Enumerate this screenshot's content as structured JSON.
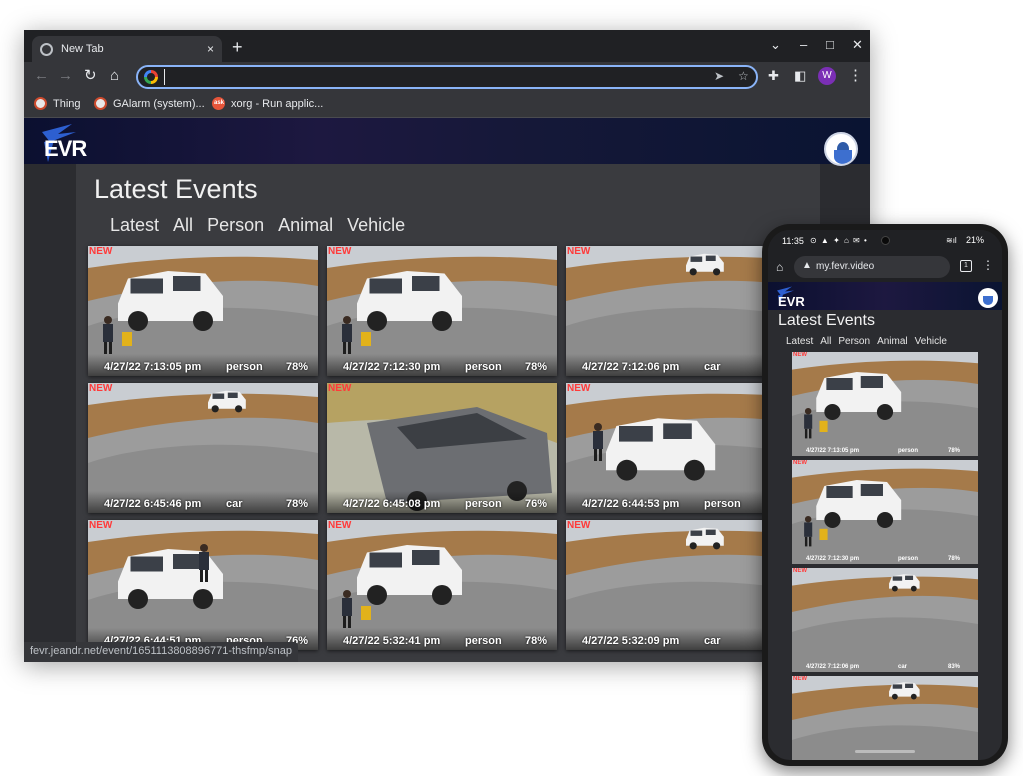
{
  "browser": {
    "tab_title": "New Tab",
    "tab_close": "×",
    "new_tab": "+",
    "window_controls": {
      "dropdown": "⌄",
      "minimize": "–",
      "maximize": "□",
      "close": "✕"
    },
    "address_value": "",
    "bookmarks": [
      {
        "label": "Thing",
        "icon": "thing-icon"
      },
      {
        "label": "GAlarm (system)...",
        "icon": "galarm-icon"
      },
      {
        "label": "xorg - Run applic...",
        "icon": "ask-icon",
        "icon_text": "ask"
      }
    ],
    "profile_initial": "W",
    "status_url": "fevr.jeandr.net/event/1651113808896771-thsfmp/snap"
  },
  "site": {
    "logo_text": "EVR",
    "page_title": "Latest Events",
    "filters": [
      "Latest",
      "All",
      "Person",
      "Animal",
      "Vehicle"
    ],
    "new_badge": "NEW",
    "events": [
      {
        "timestamp": "4/27/22 7:13:05 pm",
        "label": "person",
        "confidence": "78%",
        "scene": "suv-person"
      },
      {
        "timestamp": "4/27/22 7:12:30 pm",
        "label": "person",
        "confidence": "78%",
        "scene": "suv-person"
      },
      {
        "timestamp": "4/27/22 7:12:06 pm",
        "label": "car",
        "confidence": "",
        "scene": "far-car"
      },
      {
        "timestamp": "4/27/22 6:45:46 pm",
        "label": "car",
        "confidence": "78%",
        "scene": "far-car"
      },
      {
        "timestamp": "4/27/22 6:45:08 pm",
        "label": "person",
        "confidence": "76%",
        "scene": "minivan"
      },
      {
        "timestamp": "4/27/22 6:44:53 pm",
        "label": "person",
        "confidence": "",
        "scene": "suv-road"
      },
      {
        "timestamp": "4/27/22 6:44:51 pm",
        "label": "person",
        "confidence": "76%",
        "scene": "suv-door"
      },
      {
        "timestamp": "4/27/22 5:32:41 pm",
        "label": "person",
        "confidence": "78%",
        "scene": "suv-person"
      },
      {
        "timestamp": "4/27/22 5:32:09 pm",
        "label": "car",
        "confidence": "",
        "scene": "far-car"
      }
    ]
  },
  "phone": {
    "time": "11:35",
    "notif_icons": "⊙ ▲ ✦ ⌂ ✉ •",
    "signal": "≋ıl",
    "battery": "21%",
    "url": "my.fevr.video",
    "tab_count": "1",
    "logo_text": "EVR",
    "page_title": "Latest Events",
    "filters": [
      "Latest",
      "All",
      "Person",
      "Animal",
      "Vehicle"
    ],
    "new_badge": "NEW",
    "events": [
      {
        "timestamp": "4/27/22 7:13:05 pm",
        "label": "person",
        "confidence": "78%",
        "scene": "suv-person"
      },
      {
        "timestamp": "4/27/22 7:12:30 pm",
        "label": "person",
        "confidence": "78%",
        "scene": "suv-person"
      },
      {
        "timestamp": "4/27/22 7:12:06 pm",
        "label": "car",
        "confidence": "83%",
        "scene": "far-car"
      },
      {
        "timestamp": "",
        "label": "",
        "confidence": "",
        "scene": "far-car"
      }
    ]
  },
  "colors": {
    "accent": "#8ab4f8",
    "new_badge": "#ff3a3a",
    "header": "#151838",
    "panel": "#3a3b3f"
  }
}
